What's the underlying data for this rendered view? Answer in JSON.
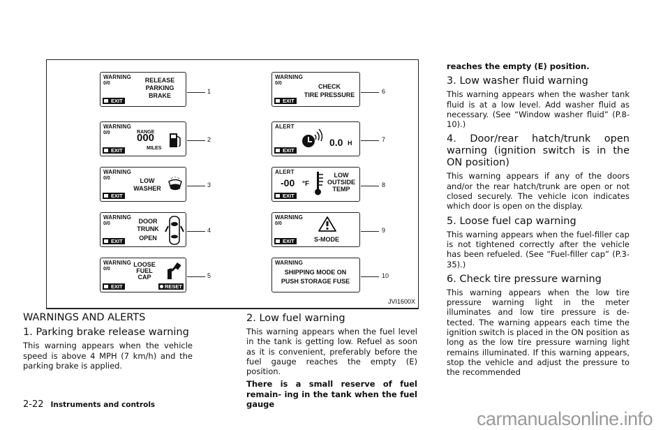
{
  "figure": {
    "id": "JVI1600X",
    "panels": [
      {
        "num": "1",
        "header": "WARNING",
        "count": "0/0",
        "message": [
          "RELEASE",
          "PARKING",
          "BRAKE"
        ],
        "exit": "EXIT",
        "icon": "none"
      },
      {
        "num": "2",
        "header": "WARNING",
        "count": "0/0",
        "range_label": "RANGE",
        "range_value": "000",
        "range_unit": "MILES",
        "exit": "EXIT",
        "icon": "fuel-pump-icon"
      },
      {
        "num": "3",
        "header": "WARNING",
        "count": "0/0",
        "message": [
          "LOW",
          "WASHER"
        ],
        "exit": "EXIT",
        "icon": "washer-icon"
      },
      {
        "num": "4",
        "header": "WARNING",
        "count": "0/0",
        "message": [
          "DOOR",
          "TRUNK",
          "OPEN"
        ],
        "exit": "EXIT",
        "icon": "vehicle-top-icon"
      },
      {
        "num": "5",
        "header": "WARNING",
        "count": "0/0",
        "message": [
          "LOOSE",
          "FUEL",
          "CAP"
        ],
        "exit": "EXIT",
        "reset": "RESET",
        "icon": "fuel-cap-icon"
      },
      {
        "num": "6",
        "header": "WARNING",
        "count": "0/0",
        "message": [
          "CHECK",
          "TIRE PRESSURE"
        ],
        "exit": "EXIT",
        "icon": "none"
      },
      {
        "num": "7",
        "header": "ALERT",
        "value": "0.0",
        "unit": "H",
        "exit": "EXIT",
        "icon": "timer-clock-icon"
      },
      {
        "num": "8",
        "header": "ALERT",
        "value": "-00",
        "unit": "°F",
        "message": [
          "LOW",
          "OUTSIDE",
          "TEMP"
        ],
        "exit": "EXIT",
        "icon": "thermometer-icon"
      },
      {
        "num": "9",
        "header": "WARNING",
        "count": "0/0",
        "message": [
          "S-MODE"
        ],
        "exit": "EXIT",
        "icon": "warning-triangle-icon"
      },
      {
        "num": "10",
        "header": "WARNING",
        "message": [
          "SHIPPING MODE ON",
          "PUSH STORAGE FUSE"
        ],
        "icon": "none"
      }
    ]
  },
  "text": {
    "main_heading": "WARNINGS AND ALERTS",
    "sections": [
      {
        "title": "1. Parking brake release warning",
        "body": "This warning appears when the vehicle speed is above 4 MPH (7 km/h) and the parking brake is applied."
      },
      {
        "title": "2. Low fuel warning",
        "body": "This warning appears when the fuel level in the tank is getting low. Refuel as soon as it is convenient, preferably before the fuel gauge reaches the empty (E) position.",
        "note_part1": "There is a small reserve of fuel remain- ing in the tank when the fuel gauge",
        "note_part2": "reaches the empty (E) position."
      },
      {
        "title": "3. Low washer fluid warning",
        "body": "This warning appears when the washer tank fluid is at a low level. Add washer fluid as necessary. (See “Window washer fluid” (P.8-10).)"
      },
      {
        "title": "4. Door/rear hatch/trunk open warning (ignition switch is in the ON position)",
        "body": "This warning appears if any of the doors and/or the rear hatch/trunk are open or not closed securely. The vehicle icon indicates which door is open on the display."
      },
      {
        "title": "5. Loose fuel cap warning",
        "body": "This warning appears when the fuel-filler cap is not tightened correctly after the vehicle has been refueled. (See “Fuel-filler cap” (P.3-35).)"
      },
      {
        "title": "6. Check tire pressure warning",
        "body": "This warning appears when the low tire pressure warning light in the meter illuminates and low tire pressure is de- tected. The warning appears each time the ignition switch is placed in the ON position as long as the low tire pressure warning light remains illuminated. If this warning appears, stop the vehicle and adjust the pressure to the recommended"
      }
    ]
  },
  "footer": {
    "page": "2-22",
    "section": "Instruments and controls"
  },
  "watermark": "carmanualsonline.info"
}
